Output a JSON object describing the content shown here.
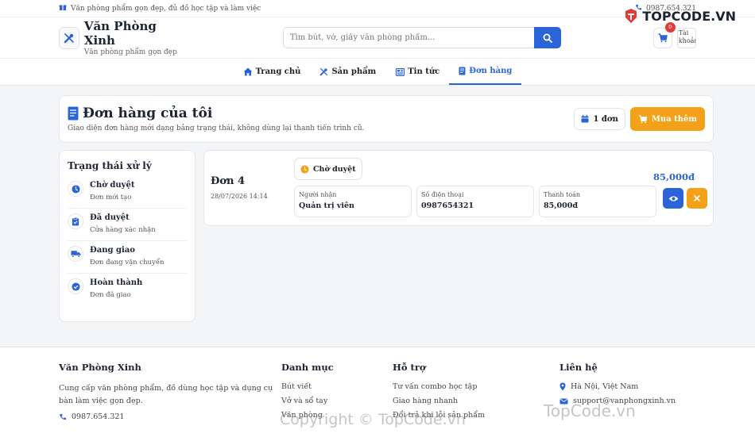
{
  "topbar": {
    "tagline": "Văn phòng phẩm gọn đẹp, đủ đồ học tập và làm việc",
    "phone": "0987.654.321"
  },
  "watermark": {
    "brand": "TOPCODE.VN",
    "site": "TopCode.vn",
    "copyright": "Copyright © TopCode.vn"
  },
  "header": {
    "brand_name": "Văn Phòng Xinh",
    "brand_sub": "Văn phòng phẩm gọn đẹp",
    "search_placeholder": "Tìm bút, vở, giấy văn phòng phẩm...",
    "cart_count": "0",
    "avatar_alt": "Tài khoản"
  },
  "nav": {
    "items": [
      {
        "label": "Trang chủ"
      },
      {
        "label": "Sản phẩm"
      },
      {
        "label": "Tin tức"
      },
      {
        "label": "Đơn hàng"
      }
    ]
  },
  "page": {
    "title": "Đơn hàng của tôi",
    "desc": "Giao diện đơn hàng mới dạng bảng trạng thái, không dùng lại thanh tiến trình cũ.",
    "count": "1 đơn",
    "buy_more": "Mua thêm"
  },
  "sidebar": {
    "title": "Trạng thái xử lý",
    "items": [
      {
        "name": "Chờ duyệt",
        "desc": "Đơn mới tạo"
      },
      {
        "name": "Đã duyệt",
        "desc": "Cửa hàng xác nhận"
      },
      {
        "name": "Đang giao",
        "desc": "Đơn đang vận chuyển"
      },
      {
        "name": "Hoàn thành",
        "desc": "Đơn đã giao"
      }
    ]
  },
  "order": {
    "id": "Đơn 4",
    "time": "28/07/2026 14:14",
    "status": "Chờ duyệt",
    "total": "85,000đ",
    "fields": [
      {
        "label": "Người nhận",
        "value": "Quản trị viên"
      },
      {
        "label": "Số điện thoại",
        "value": "0987654321"
      },
      {
        "label": "Thanh toán",
        "value": "85,000đ"
      }
    ]
  },
  "footer": {
    "about": {
      "title": "Văn Phòng Xinh",
      "text": "Cung cấp văn phòng phẩm, đồ dùng học tập và dụng cụ bàn làm việc gọn đẹp.",
      "phone": "0987.654.321"
    },
    "categories": {
      "title": "Danh mục",
      "items": [
        "Bút viết",
        "Vở và sổ tay",
        "Văn phòng"
      ]
    },
    "support": {
      "title": "Hỗ trợ",
      "items": [
        "Tư vấn combo học tập",
        "Giao hàng nhanh",
        "Đổi trả khi lỗi sản phẩm"
      ]
    },
    "contact": {
      "title": "Liên hệ",
      "address": "Hà Nội, Việt Nam",
      "email": "support@vanphongxinh.vn"
    }
  },
  "colors": {
    "primary": "#2b64d8",
    "accent": "#f4a11a",
    "pending": "#f4a11a"
  }
}
